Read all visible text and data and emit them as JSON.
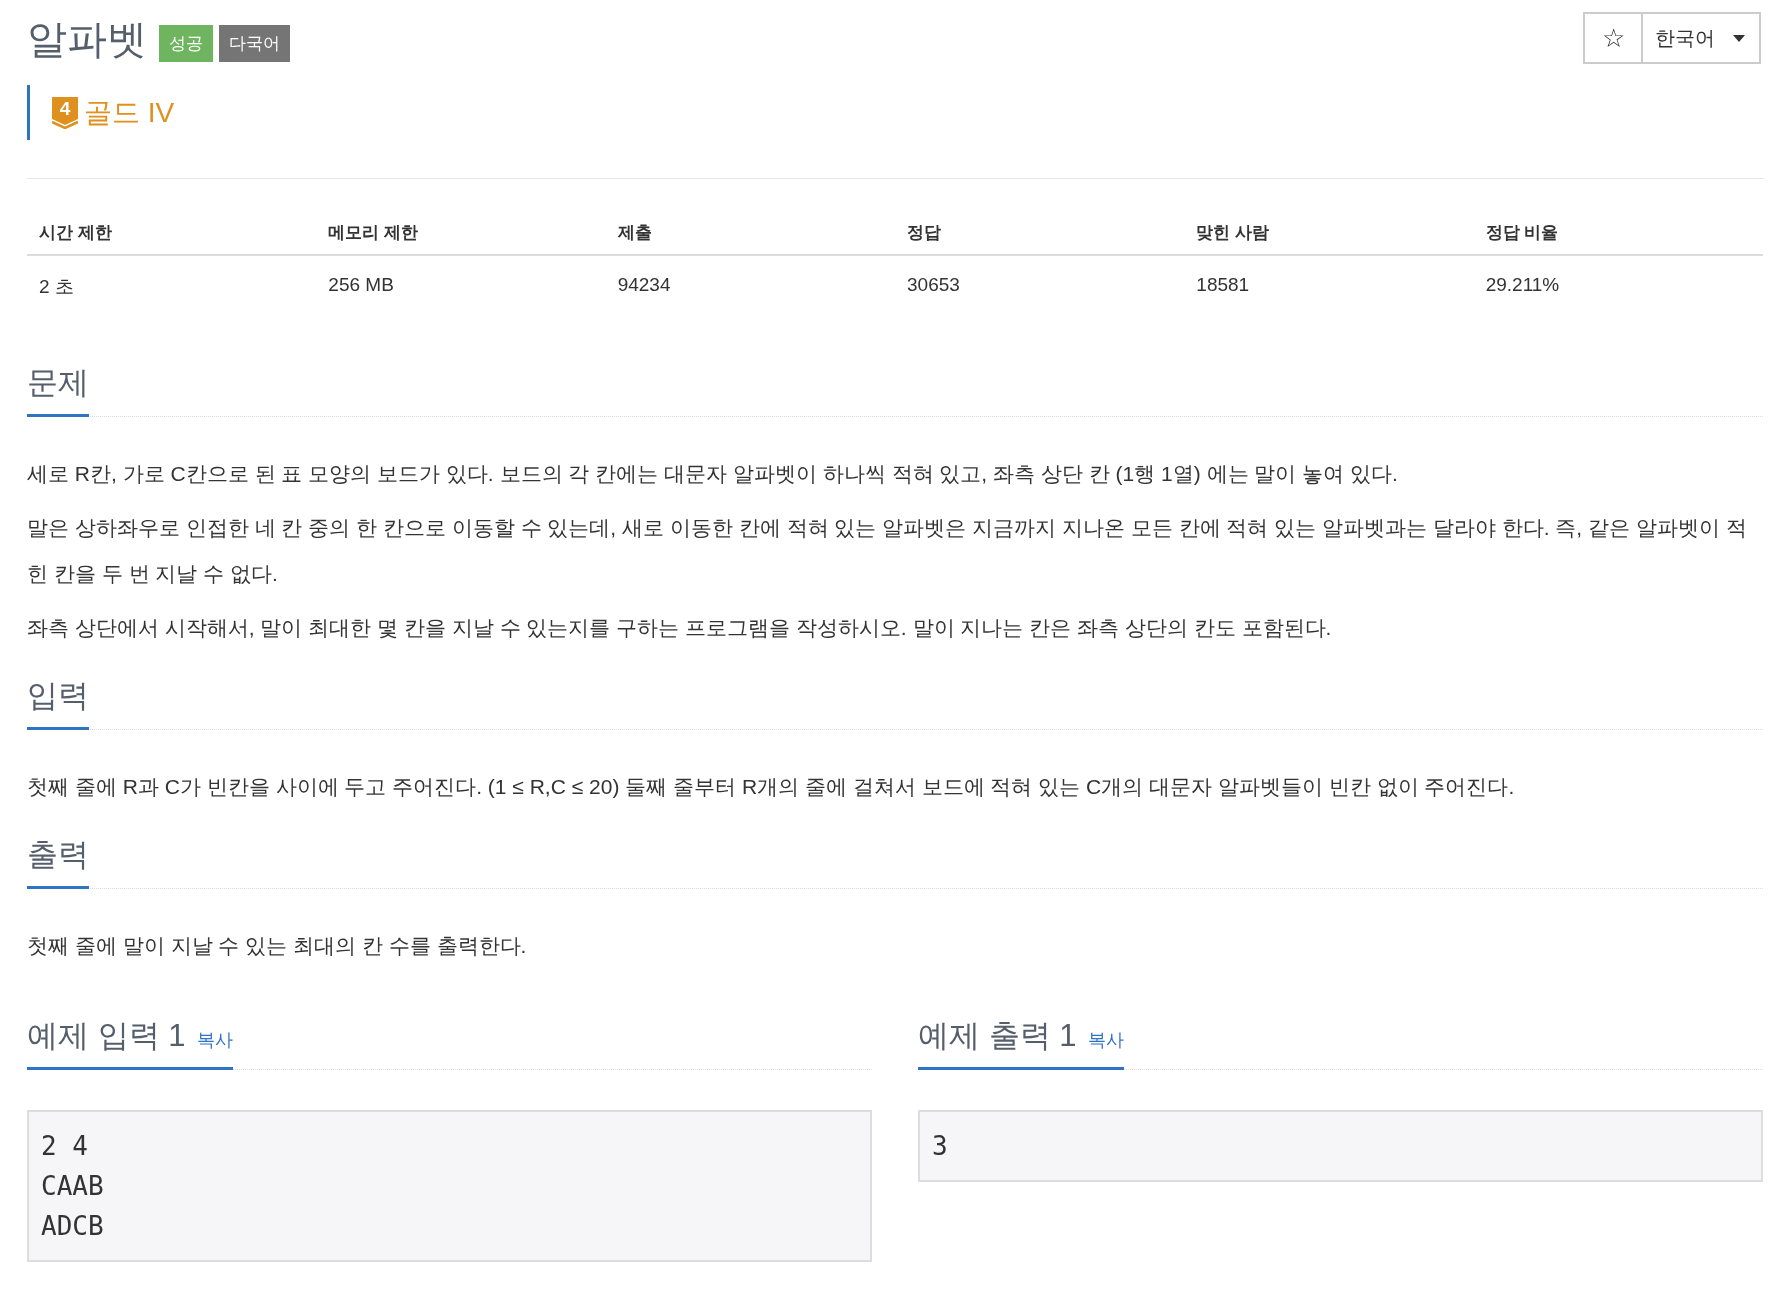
{
  "title": "알파벳",
  "badges": [
    {
      "label": "성공",
      "kind": "success"
    },
    {
      "label": "다국어",
      "kind": "multi"
    }
  ],
  "tier": {
    "number": "4",
    "label": "골드 IV"
  },
  "toolbar": {
    "star": "☆",
    "language": "한국어"
  },
  "stats": {
    "columns": [
      "시간 제한",
      "메모리 제한",
      "제출",
      "정답",
      "맞힌 사람",
      "정답 비율"
    ],
    "values": [
      "2 초",
      "256 MB",
      "94234",
      "30653",
      "18581",
      "29.211%"
    ]
  },
  "sections": [
    {
      "heading": "문제",
      "paragraphs": [
        "세로 R칸, 가로 C칸으로 된 표 모양의 보드가 있다. 보드의 각 칸에는 대문자 알파벳이 하나씩 적혀 있고, 좌측 상단 칸 (1행 1열) 에는 말이 놓여 있다.",
        "말은 상하좌우로 인접한 네 칸 중의 한 칸으로 이동할 수 있는데, 새로 이동한 칸에 적혀 있는 알파벳은 지금까지 지나온 모든 칸에 적혀 있는 알파벳과는 달라야 한다. 즉, 같은 알파벳이 적힌 칸을 두 번 지날 수 없다.",
        "좌측 상단에서 시작해서, 말이 최대한 몇 칸을 지날 수 있는지를 구하는 프로그램을 작성하시오. 말이 지나는 칸은 좌측 상단의 칸도 포함된다."
      ]
    },
    {
      "heading": "입력",
      "paragraphs": [
        "첫째 줄에 R과 C가 빈칸을 사이에 두고 주어진다. (1 ≤ R,C ≤ 20) 둘째 줄부터 R개의 줄에 걸쳐서 보드에 적혀 있는 C개의 대문자 알파벳들이 빈칸 없이 주어진다."
      ]
    },
    {
      "heading": "출력",
      "paragraphs": [
        "첫째 줄에 말이 지날 수 있는 최대의 칸 수를 출력한다."
      ]
    }
  ],
  "samples": [
    {
      "heading": "예제 입력 1",
      "copy": "복사",
      "lines": [
        "2 4",
        "CAAB",
        "ADCB"
      ]
    },
    {
      "heading": "예제 출력 1",
      "copy": "복사",
      "lines": [
        "3"
      ]
    }
  ]
}
